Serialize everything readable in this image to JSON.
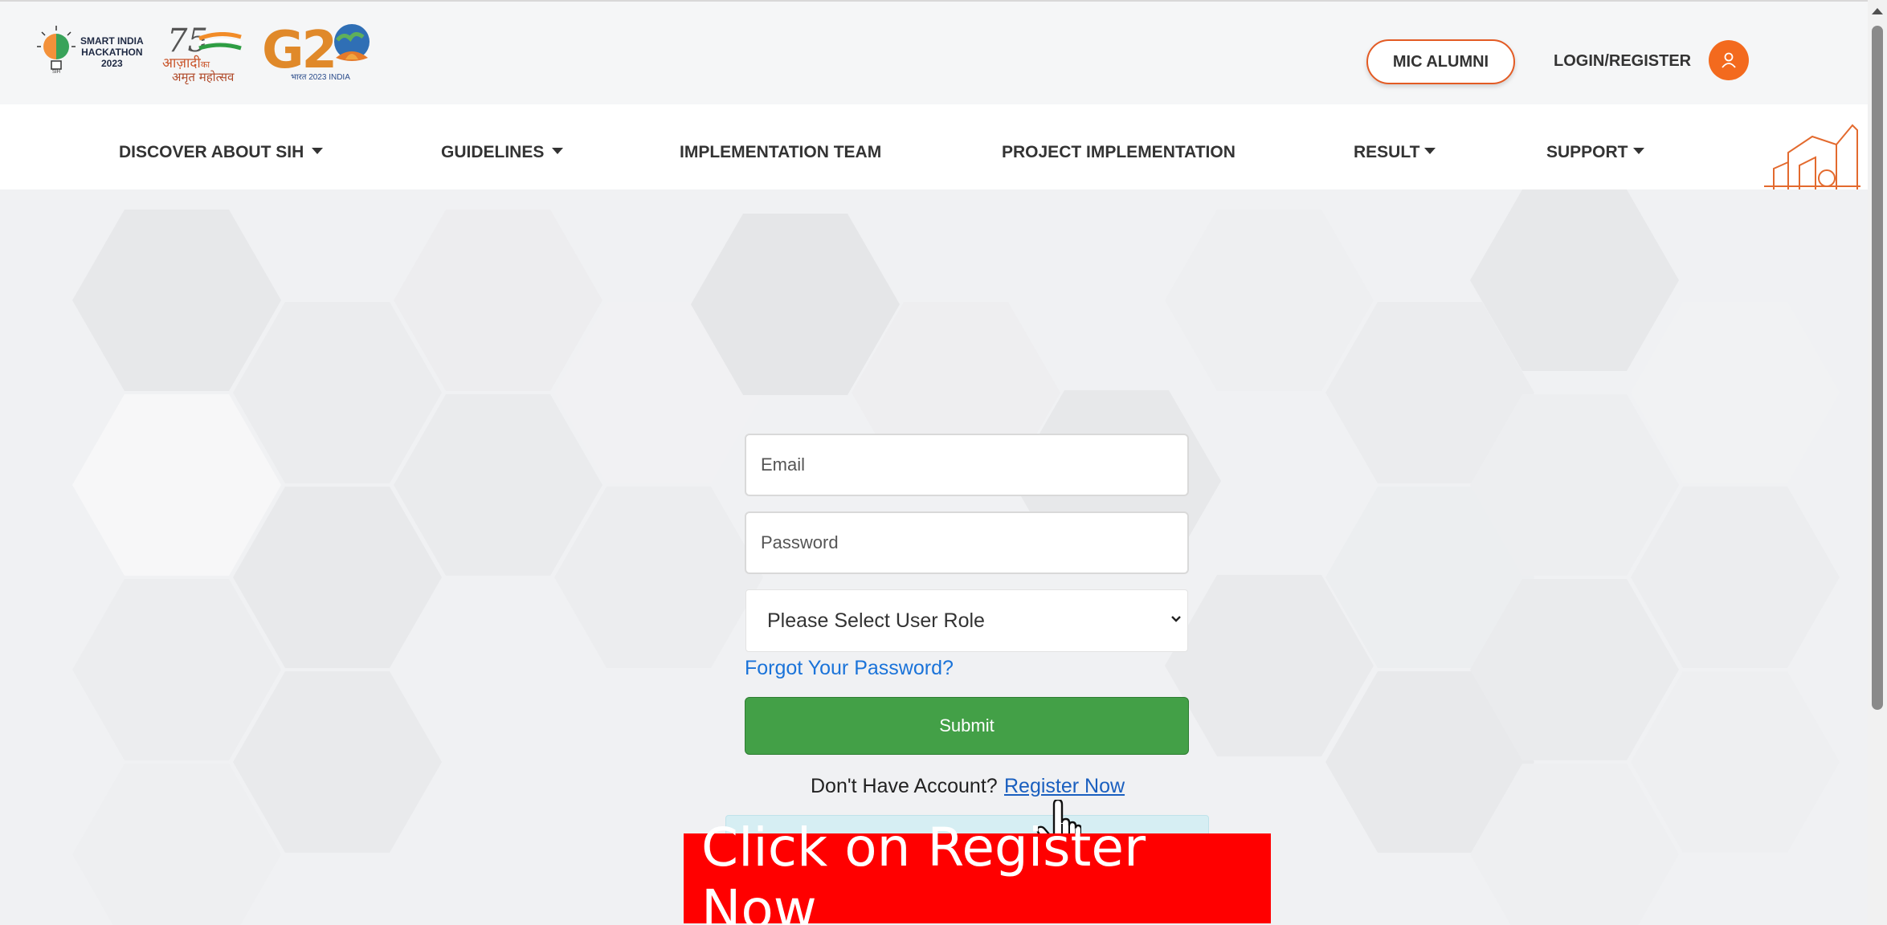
{
  "logos": {
    "sih_line1": "SMART INDIA",
    "sih_line2": "HACKATHON",
    "sih_line3": "2023",
    "azadi_number": "75",
    "azadi_line1": "आज़ादी",
    "azadi_line1_suffix": "का",
    "azadi_line2": "अमृत महोत्सव",
    "g20_text": "G2",
    "g20_sub": "भारत 2023 INDIA"
  },
  "header": {
    "alumni_button": "MIC ALUMNI",
    "login_register": "LOGIN/REGISTER"
  },
  "nav": {
    "items": [
      {
        "label": "DISCOVER ABOUT SIH",
        "dropdown": true
      },
      {
        "label": "GUIDELINES",
        "dropdown": true
      },
      {
        "label": "IMPLEMENTATION TEAM",
        "dropdown": false
      },
      {
        "label": "PROJECT IMPLEMENTATION",
        "dropdown": false
      },
      {
        "label": "RESULT",
        "dropdown": true
      },
      {
        "label": "SUPPORT",
        "dropdown": true
      }
    ]
  },
  "login_form": {
    "email_placeholder": "Email",
    "password_placeholder": "Password",
    "role_select_value": "Please Select User Role",
    "forgot_password": "Forgot Your Password?",
    "submit_label": "Submit",
    "no_account_text": "Don't Have Account?",
    "register_link": "Register Now"
  },
  "annotation": {
    "banner_text": "Click on Register Now"
  },
  "colors": {
    "accent_orange": "#f36a1e",
    "submit_green": "#43a047",
    "link_blue": "#1a73d9",
    "banner_red": "#ff0000"
  }
}
